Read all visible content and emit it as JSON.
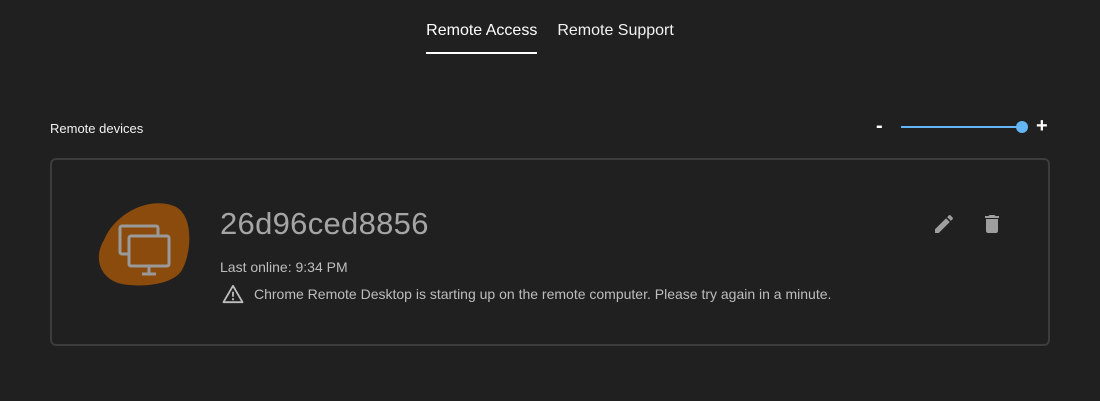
{
  "tabs": [
    {
      "label": "Remote Access",
      "active": true
    },
    {
      "label": "Remote Support",
      "active": false
    }
  ],
  "section": {
    "title": "Remote devices",
    "zoom_minus": "-",
    "zoom_plus": "+",
    "zoom_level": 1.0
  },
  "device": {
    "name": "26d96ced8856",
    "last_online": "Last online: 9:34 PM",
    "warning": "Chrome Remote Desktop is starting up on the remote computer. Please try again in a minute.",
    "icon": "multiple-monitors-icon",
    "avatar_color": "#8a4b0c"
  },
  "actions": {
    "edit_icon": "pencil-icon",
    "delete_icon": "trash-icon"
  },
  "colors": {
    "background": "#202020",
    "accent": "#64b5f6",
    "card_border": "#3c3c3c"
  }
}
